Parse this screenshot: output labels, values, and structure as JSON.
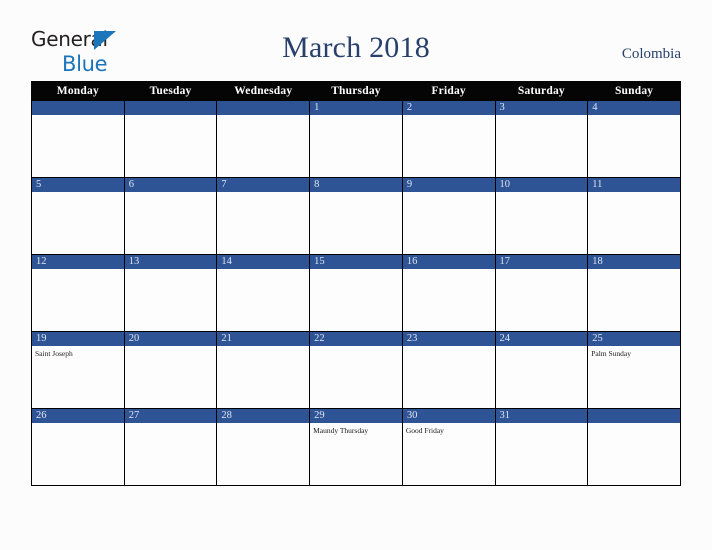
{
  "brand": {
    "line1": "General",
    "line2": "Blue",
    "triangle_color": "#1b75bb",
    "text_color": "#231f20"
  },
  "header": {
    "title": "March 2018",
    "region": "Colombia",
    "title_color": "#28406b"
  },
  "calendar": {
    "accent_color": "#2f5496",
    "header_bg": "#050505",
    "weekday_headers": [
      "Monday",
      "Tuesday",
      "Wednesday",
      "Thursday",
      "Friday",
      "Saturday",
      "Sunday"
    ],
    "weeks": [
      [
        {
          "day": "",
          "events": []
        },
        {
          "day": "",
          "events": []
        },
        {
          "day": "",
          "events": []
        },
        {
          "day": "1",
          "events": []
        },
        {
          "day": "2",
          "events": []
        },
        {
          "day": "3",
          "events": []
        },
        {
          "day": "4",
          "events": []
        }
      ],
      [
        {
          "day": "5",
          "events": []
        },
        {
          "day": "6",
          "events": []
        },
        {
          "day": "7",
          "events": []
        },
        {
          "day": "8",
          "events": []
        },
        {
          "day": "9",
          "events": []
        },
        {
          "day": "10",
          "events": []
        },
        {
          "day": "11",
          "events": []
        }
      ],
      [
        {
          "day": "12",
          "events": []
        },
        {
          "day": "13",
          "events": []
        },
        {
          "day": "14",
          "events": []
        },
        {
          "day": "15",
          "events": []
        },
        {
          "day": "16",
          "events": []
        },
        {
          "day": "17",
          "events": []
        },
        {
          "day": "18",
          "events": []
        }
      ],
      [
        {
          "day": "19",
          "events": [
            "Saint Joseph"
          ]
        },
        {
          "day": "20",
          "events": []
        },
        {
          "day": "21",
          "events": []
        },
        {
          "day": "22",
          "events": []
        },
        {
          "day": "23",
          "events": []
        },
        {
          "day": "24",
          "events": []
        },
        {
          "day": "25",
          "events": [
            "Palm Sunday"
          ]
        }
      ],
      [
        {
          "day": "26",
          "events": []
        },
        {
          "day": "27",
          "events": []
        },
        {
          "day": "28",
          "events": []
        },
        {
          "day": "29",
          "events": [
            "Maundy Thursday"
          ]
        },
        {
          "day": "30",
          "events": [
            "Good Friday"
          ]
        },
        {
          "day": "31",
          "events": []
        },
        {
          "day": "",
          "events": []
        }
      ]
    ]
  }
}
